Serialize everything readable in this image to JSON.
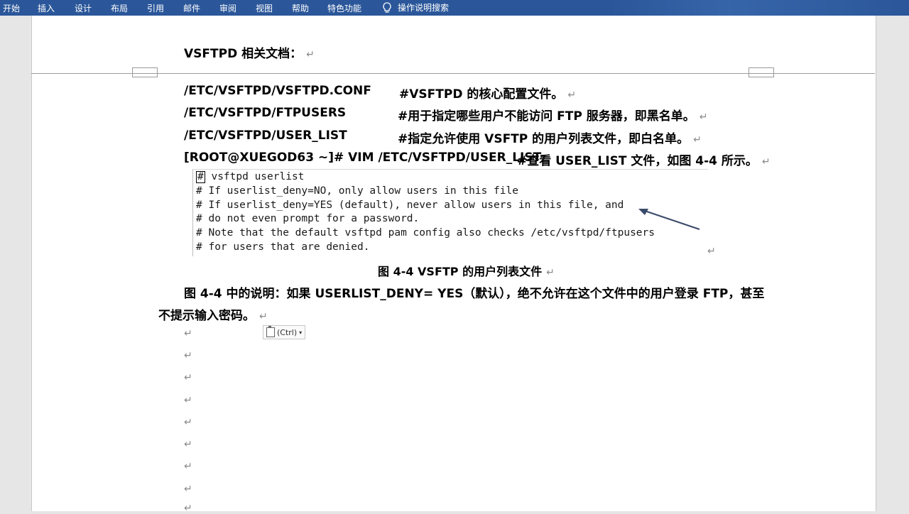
{
  "ribbon": {
    "tabs": [
      "开始",
      "插入",
      "设计",
      "布局",
      "引用",
      "邮件",
      "审阅",
      "视图",
      "帮助",
      "特色功能"
    ],
    "search_label": "操作说明搜索",
    "search_icon": "lightbulb-icon"
  },
  "document": {
    "heading": "VSFTPD  相关文档：",
    "files": [
      {
        "path": "/ETC/VSFTPD/VSFTPD.CONF",
        "comment": "#VSFTPD  的核心配置文件。"
      },
      {
        "path": "/ETC/VSFTPD/FTPUSERS",
        "comment": "#用于指定哪些用户不能访问 FTP  服务器，即黑名单。"
      },
      {
        "path": "/ETC/VSFTPD/USER_LIST",
        "comment": "#指定允许使用 VSFTP 的用户列表文件，即白名单。"
      }
    ],
    "command": "[ROOT@XUEGOD63 ~]# VIM /ETC/VSFTPD/USER_LIST",
    "command_comment": "#查看 USER_LIST 文件，如图  4-4  所示。",
    "code_lines": [
      "# vsftpd userlist",
      "# If userlist_deny=NO, only allow users in this file",
      "# If userlist_deny=YES (default), never allow users in this file, and",
      "# do not even prompt for a password.",
      "# Note that the default vsftpd pam config also checks /etc/vsftpd/ftpusers",
      "# for users that are denied."
    ],
    "caption": "图  4-4 VSFTP 的用户列表文件",
    "explanation_line1": "图 4-4 中的说明：如果 USERLIST_DENY= YES（默认），绝不允许在这个文件中的用户登录 FTP，甚至",
    "explanation_line2": "不提示输入密码。",
    "paragraph_mark": "↵",
    "paste_options": "(Ctrl)",
    "paste_icon": "clipboard-icon"
  }
}
